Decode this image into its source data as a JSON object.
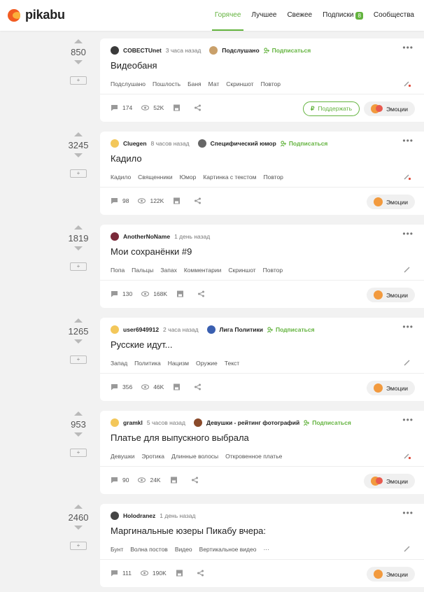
{
  "app": {
    "logo_text": "pikabu"
  },
  "nav": {
    "items": [
      {
        "label": "Горячее",
        "active": true
      },
      {
        "label": "Лучшее"
      },
      {
        "label": "Свежее"
      },
      {
        "label": "Подписки",
        "badge": "8"
      },
      {
        "label": "Сообщества"
      }
    ]
  },
  "colors": {
    "accent": "#63b33e",
    "brand": "#f25c22"
  },
  "stories": [
    {
      "rating": "850",
      "author": "COBECTUnet",
      "time": "3 часа назад",
      "community": "Подслушано",
      "subscribe": "Подписаться",
      "title": "Видеобаня",
      "tags": [
        "Подслушано",
        "Пошлость",
        "Баня",
        "Мат",
        "Скриншот",
        "Повтор"
      ],
      "comments": "174",
      "views": "52K",
      "support": "Поддержать",
      "emotions": "Эмоции"
    },
    {
      "rating": "3245",
      "author": "Cluegen",
      "time": "8 часов назад",
      "community": "Специфический юмор",
      "subscribe": "Подписаться",
      "title": "Кадило",
      "tags": [
        "Кадило",
        "Священники",
        "Юмор",
        "Картинка с текстом",
        "Повтор"
      ],
      "comments": "98",
      "views": "122K",
      "emotions": "Эмоции"
    },
    {
      "rating": "1819",
      "author": "AnotherNoName",
      "time": "1 день назад",
      "title": "Мои сохранёнки #9",
      "tags": [
        "Попа",
        "Пальцы",
        "Запах",
        "Комментарии",
        "Скриншот",
        "Повтор"
      ],
      "comments": "130",
      "views": "168K",
      "emotions": "Эмоции"
    },
    {
      "rating": "1265",
      "author": "user6949912",
      "time": "2 часа назад",
      "community": "Лига Политики",
      "subscribe": "Подписаться",
      "title": "Русские идут...",
      "tags": [
        "Запад",
        "Политика",
        "Нацизм",
        "Оружие",
        "Текст"
      ],
      "comments": "356",
      "views": "46K",
      "emotions": "Эмоции"
    },
    {
      "rating": "953",
      "author": "gramkl",
      "time": "5 часов назад",
      "community": "Девушки - рейтинг фотографий",
      "subscribe": "Подписаться",
      "title": "Платье для выпускного выбрала",
      "tags": [
        "Девушки",
        "Эротика",
        "Длинные волосы",
        "Откровенное платье"
      ],
      "comments": "90",
      "views": "24K",
      "emotions": "Эмоции"
    },
    {
      "rating": "2460",
      "author": "Holodranez",
      "time": "1 день назад",
      "title": "Маргинальные юзеры Пикабу вчера:",
      "tags": [
        "Бунт",
        "Волна постов",
        "Видео",
        "Вертикальное видео",
        "···"
      ],
      "comments": "111",
      "views": "190K",
      "emotions": "Эмоции"
    }
  ]
}
